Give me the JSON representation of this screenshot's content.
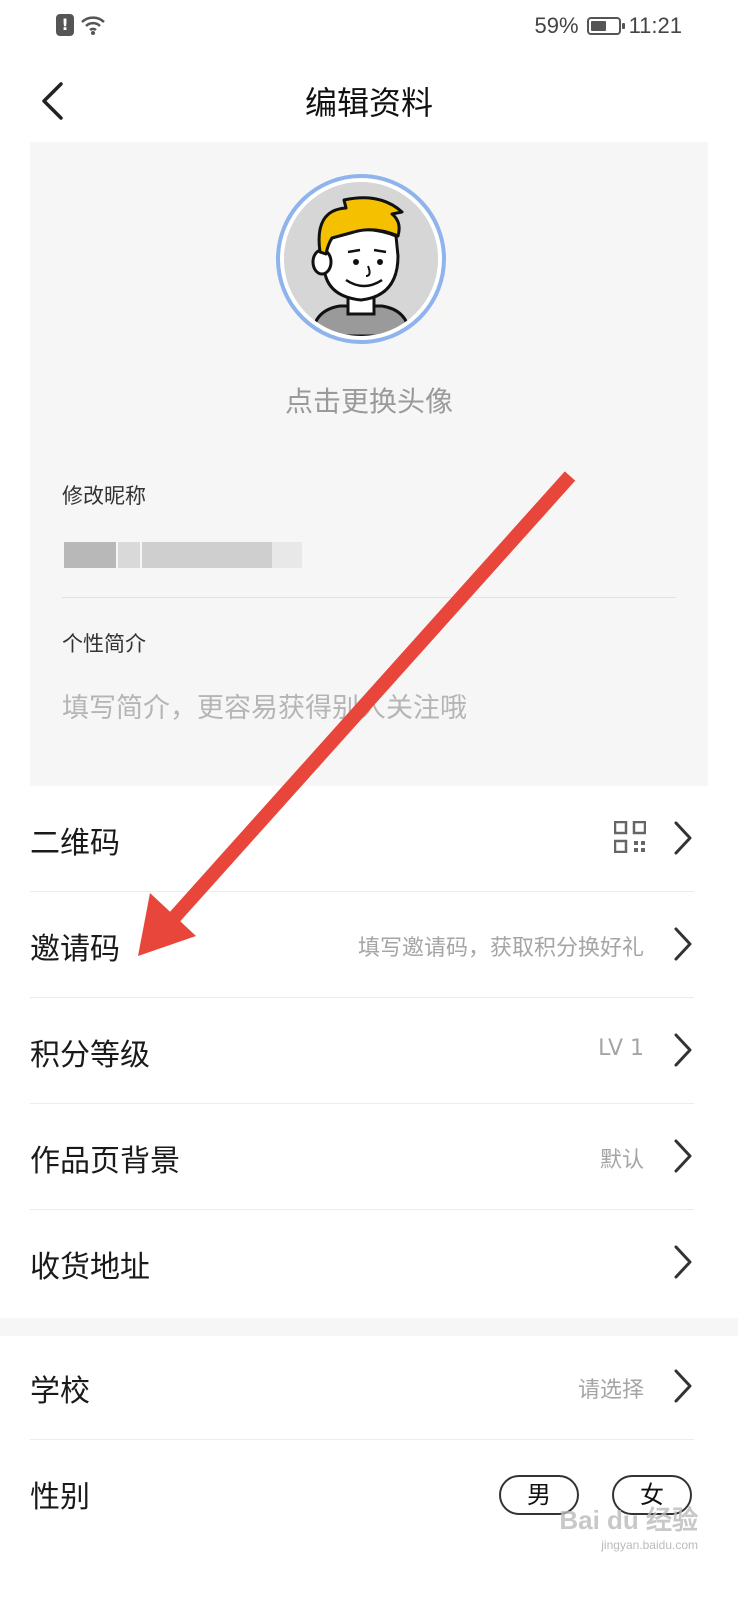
{
  "status_bar": {
    "battery": "59%",
    "battery_level": 0.59,
    "time": "11:21",
    "alert": "!"
  },
  "header": {
    "title": "编辑资料"
  },
  "profile": {
    "change_avatar": "点击更换头像",
    "nickname_label": "修改昵称",
    "bio_label": "个性简介",
    "bio_placeholder": "填写简介，更容易获得别人关注哦"
  },
  "menu": [
    {
      "label": "二维码",
      "value": ""
    },
    {
      "label": "邀请码",
      "value": "填写邀请码，获取积分换好礼"
    },
    {
      "label": "积分等级",
      "value": "LV 1"
    },
    {
      "label": "作品页背景",
      "value": "默认"
    },
    {
      "label": "收货地址",
      "value": ""
    }
  ],
  "menu2": [
    {
      "label": "学校",
      "value": "请选择"
    },
    {
      "label": "性别",
      "options": [
        "男",
        "女"
      ]
    }
  ],
  "annotation": {
    "arrow_color": "#e8463a"
  },
  "watermark": {
    "text": "Bai du 经验",
    "sub": "jingyan.baidu.com"
  }
}
